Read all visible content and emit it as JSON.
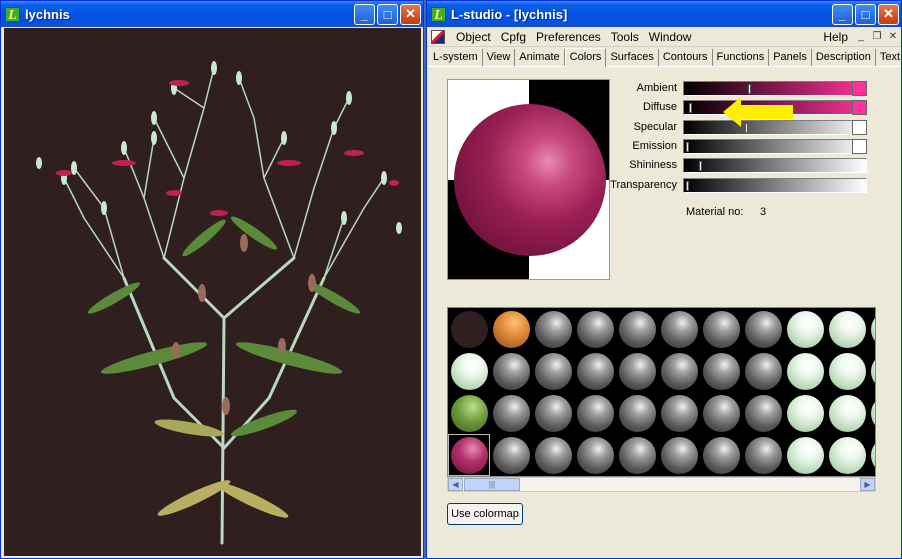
{
  "left_window": {
    "title": "lychnis",
    "icon_letter": "L"
  },
  "right_window": {
    "title": "L-studio - [lychnis]",
    "icon_letter": "L",
    "menu": [
      "Object",
      "Cpfg",
      "Preferences",
      "Tools",
      "Window"
    ],
    "help_label": "Help",
    "tabs": [
      "L-system",
      "View",
      "Animate",
      "Colors",
      "Surfaces",
      "Contours",
      "Functions",
      "Panels",
      "Description",
      "Text file"
    ],
    "active_tab": "Colors"
  },
  "material": {
    "sliders": [
      {
        "label": "Ambient",
        "level": 0.38,
        "swatch": "#ff3399",
        "gradient_to": "#ff3399"
      },
      {
        "label": "Diffuse",
        "level": 0.02,
        "swatch": "#ff3399",
        "gradient_to": "#ff3399"
      },
      {
        "label": "Specular",
        "level": 0.36,
        "swatch": "#ffffff",
        "gradient_to": "#ffffff"
      },
      {
        "label": "Emission",
        "level": 0.0,
        "swatch": "#ffffff",
        "gradient_to": "#ffffff"
      },
      {
        "label": "Shininess",
        "level": 0.08,
        "swatch": "",
        "gradient_to": "#ffffff"
      },
      {
        "label": "Transparency",
        "level": 0.0,
        "swatch": "",
        "gradient_to": "#ffffff"
      }
    ],
    "material_no_label": "Material no:",
    "material_no": "3"
  },
  "palette": {
    "rows": [
      [
        "dark",
        "orange",
        "gray",
        "gray",
        "gray",
        "gray",
        "gray",
        "gray",
        "white",
        "white",
        "white"
      ],
      [
        "white",
        "gray",
        "gray",
        "gray",
        "gray",
        "gray",
        "gray",
        "gray",
        "white",
        "white",
        "white"
      ],
      [
        "green",
        "gray",
        "gray",
        "gray",
        "gray",
        "gray",
        "gray",
        "gray",
        "white",
        "white",
        "white"
      ],
      [
        "magenta",
        "gray",
        "gray",
        "gray",
        "gray",
        "gray",
        "gray",
        "gray",
        "white",
        "white",
        "white"
      ]
    ],
    "selected": [
      3,
      0
    ]
  },
  "use_colormap_label": "Use colormap",
  "icons": {
    "minimize": "minimize-icon",
    "maximize": "maximize-icon",
    "close": "close-icon"
  }
}
